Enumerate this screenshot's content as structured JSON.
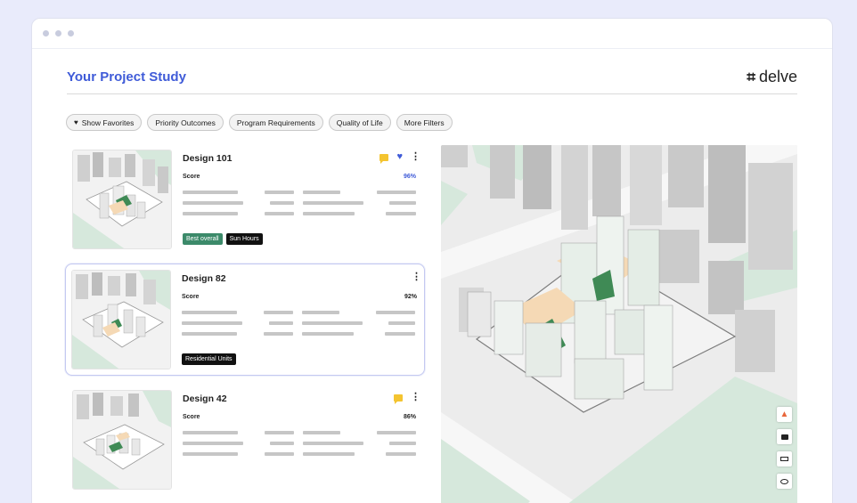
{
  "header": {
    "title": "Your Project Study",
    "brand_name": "delve",
    "brand_mark": "⌗"
  },
  "filters": [
    {
      "label": "Show Favorites",
      "icon": "heart-icon"
    },
    {
      "label": "Priority Outcomes"
    },
    {
      "label": "Program Requirements"
    },
    {
      "label": "Quality of Life"
    },
    {
      "label": "More Filters"
    }
  ],
  "designs": [
    {
      "name": "Design 101",
      "score_label": "Score",
      "score": "96%",
      "favorite": true,
      "flagged": true,
      "tags": [
        "Best overall",
        "Sun Hours"
      ]
    },
    {
      "name": "Design 82",
      "score_label": "Score",
      "score": "92%",
      "favorite": false,
      "flagged": false,
      "selected": true,
      "tags": [
        "Residential Units"
      ]
    },
    {
      "name": "Design 42",
      "score_label": "Score",
      "score": "86%",
      "favorite": false,
      "flagged": true,
      "tags": []
    }
  ],
  "colors": {
    "accent": "#3f5bd8",
    "tag_green": "#3c8a6a",
    "flag": "#f4c430",
    "green_space": "#d6e8dc"
  },
  "map_controls": [
    "compass-icon",
    "comment-icon",
    "ruler-icon",
    "eye-icon"
  ]
}
